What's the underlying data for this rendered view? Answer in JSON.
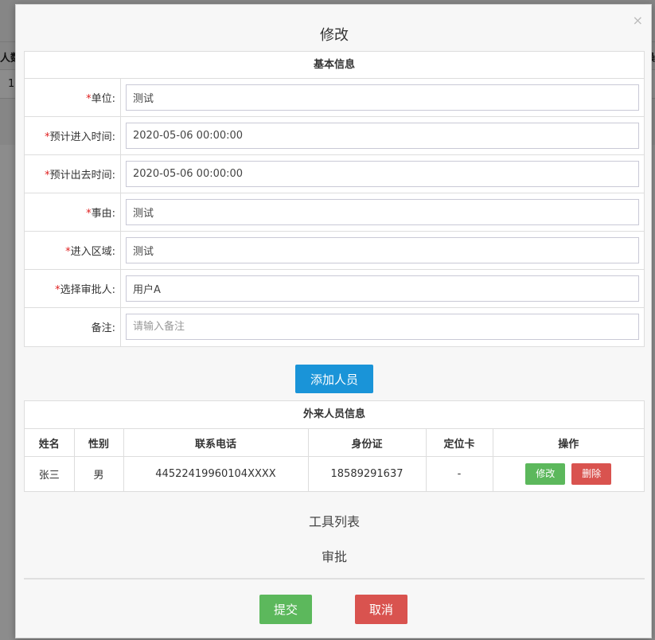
{
  "background": {
    "header_left": "人数",
    "row_left": "1",
    "header_right": "操"
  },
  "modal": {
    "title": "修改",
    "close": "×"
  },
  "basic_info": {
    "heading": "基本信息",
    "fields": [
      {
        "label": "单位:",
        "required": true,
        "value": "测试",
        "placeholder": ""
      },
      {
        "label": "预计进入时间:",
        "required": true,
        "value": "2020-05-06 00:00:00",
        "placeholder": ""
      },
      {
        "label": "预计出去时间:",
        "required": true,
        "value": "2020-05-06 00:00:00",
        "placeholder": ""
      },
      {
        "label": "事由:",
        "required": true,
        "value": "测试",
        "placeholder": ""
      },
      {
        "label": "进入区域:",
        "required": true,
        "value": "测试",
        "placeholder": ""
      },
      {
        "label": "选择审批人:",
        "required": true,
        "value": "用户A",
        "placeholder": ""
      },
      {
        "label": "备注:",
        "required": false,
        "value": "",
        "placeholder": "请输入备注"
      }
    ]
  },
  "add_person_label": "添加人员",
  "visitors": {
    "heading": "外来人员信息",
    "columns": [
      "姓名",
      "性别",
      "联系电话",
      "身份证",
      "定位卡",
      "操作"
    ],
    "rows": [
      {
        "name": "张三",
        "gender": "男",
        "phone": "44522419960104XXXX",
        "id_card": "18589291637",
        "card": "-"
      }
    ],
    "edit_label": "修改",
    "delete_label": "删除"
  },
  "tools_title": "工具列表",
  "approval_title": "审批",
  "footer": {
    "submit_label": "提交",
    "cancel_label": "取消"
  },
  "colors": {
    "primary": "#1a94d8",
    "success": "#5cb85c",
    "danger": "#d9534f",
    "required": "#e02020"
  }
}
